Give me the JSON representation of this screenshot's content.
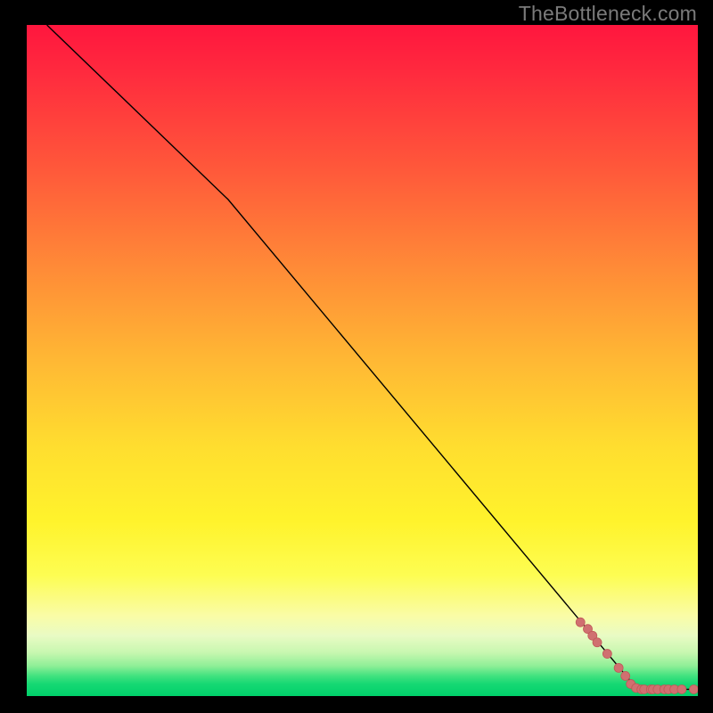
{
  "watermark": "TheBottleneck.com",
  "colors": {
    "frame_bg": "#000000",
    "line": "#000000",
    "marker_fill": "#d07070",
    "marker_stroke": "#c05858"
  },
  "chart_data": {
    "type": "line",
    "title": "",
    "xlabel": "",
    "ylabel": "",
    "xlim": [
      0,
      100
    ],
    "ylim": [
      0,
      100
    ],
    "line": {
      "x": [
        3,
        30,
        91,
        100
      ],
      "y": [
        100,
        74,
        1,
        1
      ]
    },
    "markers": {
      "x": [
        82.5,
        83.6,
        84.3,
        85.0,
        86.5,
        88.2,
        89.2,
        90.0,
        90.8,
        91.6,
        92.0,
        93.0,
        93.3,
        94.0,
        95.0,
        95.6,
        96.5,
        97.6,
        99.4
      ],
      "y": [
        11.0,
        10.0,
        9.0,
        8.0,
        6.3,
        4.2,
        3.0,
        1.8,
        1.2,
        1.0,
        1.0,
        1.0,
        1.0,
        1.0,
        1.0,
        1.0,
        1.0,
        1.0,
        1.0
      ]
    },
    "marker_radius": 5
  }
}
